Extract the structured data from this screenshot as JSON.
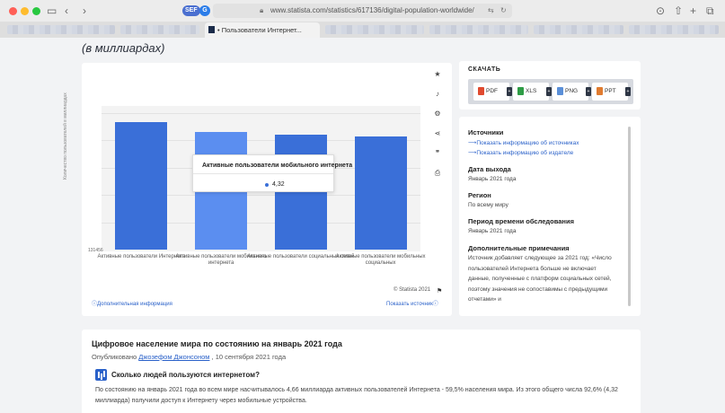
{
  "browser": {
    "url": "www.statista.com/statistics/617136/digital-population-worldwide/",
    "active_tab_title": "• Пользователи Интернет...",
    "ext_badge_1": "SEF",
    "ext_badge_2": "G"
  },
  "page": {
    "heading": "(в миллиардах)"
  },
  "chart_data": {
    "type": "bar",
    "categories": [
      "Активные пользователи Интернета",
      "Активные пользователи мобильного интернета",
      "Активные пользователи социальных сетей",
      "Активные пользователи мобильных социальных"
    ],
    "values": [
      4.66,
      4.32,
      4.2,
      4.15
    ],
    "ylabel": "Количество пользователей в миллиардах",
    "zero_tick": "131456",
    "highlight_index": 1,
    "tooltip": {
      "title": "Активные пользователи мобильного интернета",
      "value": "4,32"
    },
    "colors": {
      "bar": "#3a6fd8",
      "highlight": "#5b8ef0"
    }
  },
  "chart_footer": {
    "copyright": "© Statista 2021",
    "more_info_link": "ⓘДополнительная информация",
    "show_sources_link": "Показать источникⓘ"
  },
  "download": {
    "title": "СКАЧАТЬ",
    "buttons": [
      {
        "label": "PDF",
        "color": "#e04a2f"
      },
      {
        "label": "XLS",
        "color": "#2e9c46"
      },
      {
        "label": "PNG",
        "color": "#5a8fd8"
      },
      {
        "label": "PPT",
        "color": "#e07b2f"
      }
    ]
  },
  "info": {
    "sources_h": "Источники",
    "sources_link": "⟶Показать информацию об источниках",
    "publisher_link": "⟶Показать информацию об издателе",
    "release_h": "Дата выхода",
    "release_v": "Январь 2021 года",
    "region_h": "Регион",
    "region_v": "По всему миру",
    "period_h": "Период времени обследования",
    "period_v": "Январь 2021 года",
    "notes_h": "Дополнительные примечания",
    "notes_v": "Источник добавляет следующее за 2021 год: «Число пользователей Интернета больше не включает данные, полученные с платформ социальных сетей, поэтому значения не сопоставимы с предыдущими отчетами» и"
  },
  "article": {
    "title": "Цифровое население мира по состоянию на январь 2021 года",
    "pub_prefix": "Опубликовано ",
    "author": "Джозефом Джонсоном",
    "pub_suffix": " , 10 сентября 2021 года",
    "question": "Сколько людей пользуются интернетом?",
    "body": "По состоянию на январь 2021 года во всем мире насчитывалось 4,66 миллиарда активных пользователей Интернета - 59,5% населения мира. Из этого общего числа 92,6% (4,32 миллиарда) получили доступ к Интернету через мобильные устройства."
  }
}
